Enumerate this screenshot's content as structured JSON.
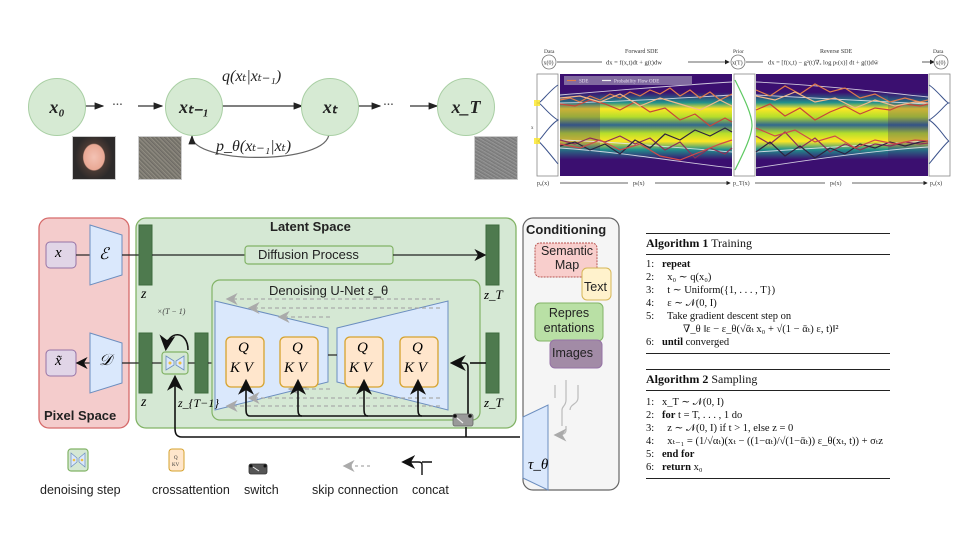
{
  "markov_chain": {
    "nodes": [
      "x₀",
      "xₜ₋₁",
      "xₜ",
      "x_T"
    ],
    "ellipsis": "···",
    "forward_label": "q(xₜ|xₜ₋₁)",
    "reverse_label": "p_θ(xₜ₋₁|xₜ)",
    "thumbnails": [
      "clean-face-image",
      "noisy-face-image",
      "pure-noise-image"
    ]
  },
  "sde_figure": {
    "data_left": "Data",
    "data_left_node": "x(0)",
    "forward_title": "Forward SDE",
    "forward_eq": "dx = f(x,t)dt + g(t)dw",
    "prior": "Prior",
    "prior_node": "x(T)",
    "reverse_title": "Reverse SDE",
    "reverse_eq": "dx = [f(x,t) − g²(t)∇ₓ log pₜ(x)] dt + g(t)dw̄",
    "data_right": "Data",
    "data_right_node": "x(0)",
    "legend": [
      "SDE",
      "Probability Flow ODE"
    ],
    "y_label": "x",
    "bottom_labels": [
      "p₀(x)",
      "pₜ(x)",
      "p_T(x)",
      "pₜ(x)",
      "p₀(x)"
    ]
  },
  "ldm": {
    "pixel_space": "Pixel Space",
    "latent_space": "Latent Space",
    "conditioning": "Conditioning",
    "x": "x",
    "x_tilde": "x̃",
    "encoder": "ℰ",
    "decoder": "𝒟",
    "z": "z",
    "z_T": "z_T",
    "z_T_minus_1": "z_{T−1}",
    "diffusion_process": "Diffusion Process",
    "unet_title": "Denoising U-Net ε_θ",
    "repeat": "×(T − 1)",
    "qkv_q": "Q",
    "qkv_kv": "K V",
    "tau": "τ_θ",
    "cond_items": [
      "Semantic Map",
      "Text",
      "Repres entations",
      "Images"
    ],
    "legend": [
      "denoising step",
      "crossattention",
      "switch",
      "skip connection",
      "concat"
    ],
    "colors": {
      "pixel_bg": "#f4cccc",
      "pixel_border": "#d66b6b",
      "latent_bg": "#d5e8d4",
      "latent_border": "#82b366",
      "block": "#4e7a4e",
      "trapezoid": "#dae8fc",
      "trapezoid_border": "#6c8ebf",
      "qkv_bg": "#ffe6cc",
      "qkv_border": "#d6a32e",
      "cond_bg": "#f5f5f5"
    }
  },
  "algorithm1": {
    "title_bold": "Algorithm 1",
    "title_rest": " Training",
    "lines": [
      {
        "n": "1:",
        "kw": "repeat",
        "text": ""
      },
      {
        "n": "2:",
        "kw": "",
        "text": "  x₀ ∼ q(x₀)"
      },
      {
        "n": "3:",
        "kw": "",
        "text": "  t ∼ Uniform({1, . . . , T})"
      },
      {
        "n": "4:",
        "kw": "",
        "text": "  ε ∼ 𝒩(0, I)"
      },
      {
        "n": "5:",
        "kw": "",
        "text": "  Take gradient descent step on"
      },
      {
        "n": "",
        "kw": "",
        "text": "        ∇_θ ‖ε − ε_θ(√ᾱₜ x₀ + √(1 − ᾱₜ) ε, t)‖²"
      },
      {
        "n": "6:",
        "kw": "until",
        "text": " converged"
      }
    ]
  },
  "algorithm2": {
    "title_bold": "Algorithm 2",
    "title_rest": " Sampling",
    "lines": [
      {
        "n": "1:",
        "kw": "",
        "text": "x_T ∼ 𝒩(0, I)"
      },
      {
        "n": "2:",
        "kw": "for",
        "text": " t = T, . . . , 1 do"
      },
      {
        "n": "3:",
        "kw": "",
        "text": "  z ∼ 𝒩(0, I) if t > 1, else z = 0"
      },
      {
        "n": "4:",
        "kw": "",
        "text": "  xₜ₋₁ = (1/√αₜ)(xₜ − ((1−αₜ)/√(1−ᾱₜ)) ε_θ(xₜ, t)) + σₜz"
      },
      {
        "n": "5:",
        "kw": "end for",
        "text": ""
      },
      {
        "n": "6:",
        "kw": "return",
        "text": " x₀"
      }
    ]
  }
}
